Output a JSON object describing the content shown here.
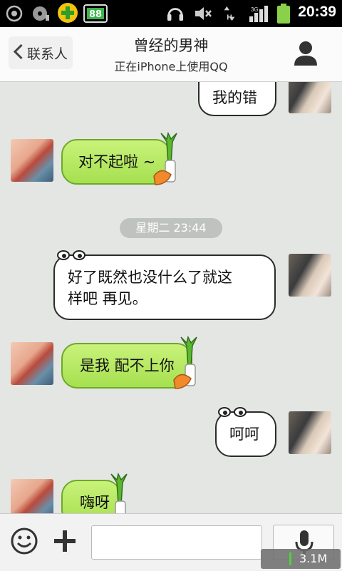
{
  "status_bar": {
    "time": "20:39",
    "icons": [
      "record-icon",
      "cd-icon",
      "security-plus-icon",
      "battery-app-icon",
      "headset-icon",
      "mute-icon",
      "data-transfer-icon",
      "signal-3g-icon",
      "battery-icon"
    ]
  },
  "header": {
    "back_label": "联系人",
    "title": "曾经的男神",
    "subtitle": "正在iPhone上使用QQ",
    "profile_icon": "person-icon"
  },
  "chat": {
    "timestamp": "星期二 23:44",
    "messages": [
      {
        "side": "right",
        "style": "white",
        "text": "我的错"
      },
      {
        "side": "left",
        "style": "green",
        "text": "对不起啦 ~"
      },
      {
        "side": "right",
        "style": "white",
        "text_line1": "好了既然也没什么了就这",
        "text_line2": "样吧 再见。"
      },
      {
        "side": "left",
        "style": "green",
        "text": "是我 配不上你"
      },
      {
        "side": "right",
        "style": "white",
        "text": "呵呵"
      },
      {
        "side": "left",
        "style": "green",
        "text": "嗨呀"
      }
    ]
  },
  "input_bar": {
    "emoji_icon": "smiley-icon",
    "plus_icon": "plus-icon",
    "input_value": "",
    "voice_icon": "microphone-icon"
  },
  "net_speed": "3.1M",
  "colors": {
    "green_bubble": "#b5e865",
    "green_border": "#6fa82a",
    "chat_bg": "#e3e6e3",
    "timestamp_bg": "#bfc3c0"
  }
}
